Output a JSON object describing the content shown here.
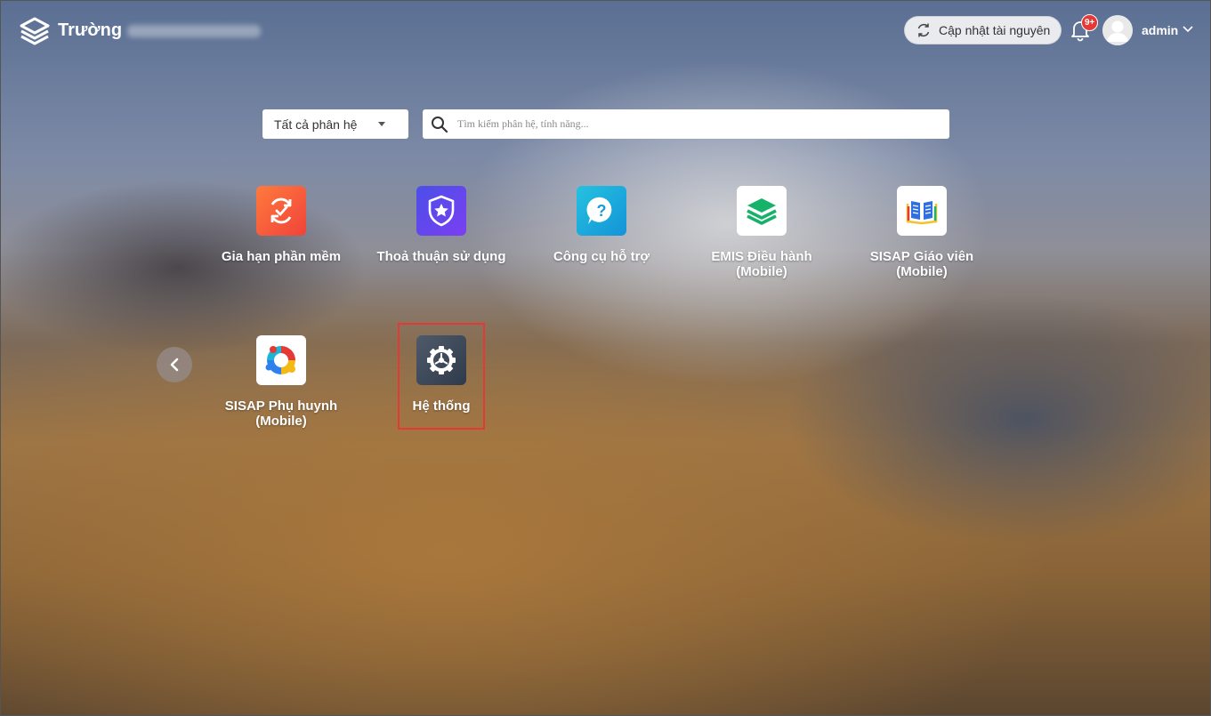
{
  "header": {
    "title": "Trường",
    "update_button": "Cập nhật tài nguyên",
    "notification_badge": "9+",
    "user_name": "admin"
  },
  "filters": {
    "category_select": "Tất cả phân hệ",
    "search_placeholder": "Tìm kiếm phân hệ, tính năng..."
  },
  "apps": [
    {
      "label": "Gia hạn phần mềm"
    },
    {
      "label": "Thoả thuận sử dụng"
    },
    {
      "label": "Công cụ hỗ trợ"
    },
    {
      "label": "EMIS Điều hành (Mobile)"
    },
    {
      "label": "SISAP Giáo viên (Mobile)"
    },
    {
      "label": "SISAP Phụ huynh (Mobile)"
    },
    {
      "label": "Hệ thống"
    }
  ],
  "colors": {
    "highlight": "#e53935",
    "badge": "#e53935"
  }
}
